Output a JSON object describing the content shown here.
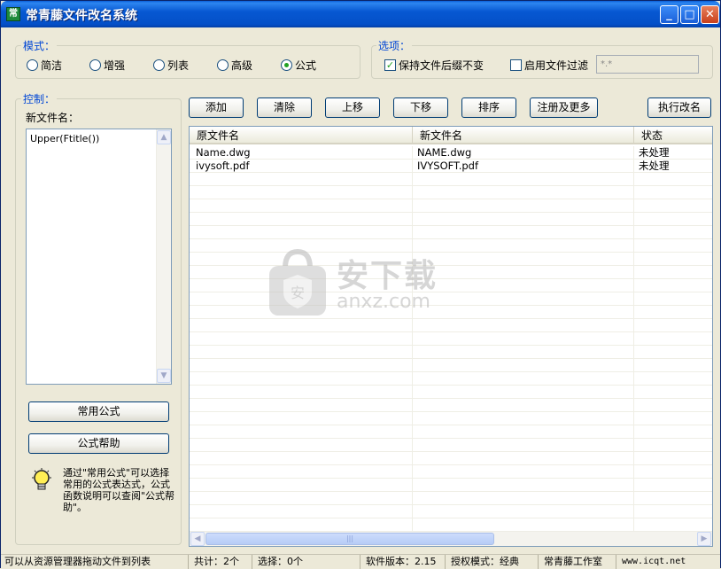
{
  "window": {
    "title": "常青藤文件改名系统",
    "icon_glyph": "常",
    "minimize_glyph": "_",
    "maximize_glyph": "□",
    "close_glyph": "✕"
  },
  "mode": {
    "legend": "模式：",
    "options": [
      {
        "label": "简洁",
        "selected": false
      },
      {
        "label": "增强",
        "selected": false
      },
      {
        "label": "列表",
        "selected": false
      },
      {
        "label": "高级",
        "selected": false
      },
      {
        "label": "公式",
        "selected": true
      }
    ]
  },
  "options": {
    "legend": "选项：",
    "keep_ext_label": "保持文件后缀不变",
    "keep_ext_checked": true,
    "filter_label": "启用文件过滤",
    "filter_checked": false,
    "filter_value": "*.*",
    "check_glyph": "✓"
  },
  "control": {
    "legend": "控制：",
    "new_name_label": "新文件名：",
    "formula": "Upper(Ftitle())",
    "common_formula_button": "常用公式",
    "formula_help_button": "公式帮助",
    "tip": "通过\"常用公式\"可以选择常用的公式表达式，公式函数说明可以查阅\"公式帮助\"。",
    "scroll_up_glyph": "▲",
    "scroll_down_glyph": "▼"
  },
  "toolbar": {
    "add": "添加",
    "clear": "清除",
    "move_up": "上移",
    "move_down": "下移",
    "sort": "排序",
    "register": "注册及更多",
    "execute": "执行改名"
  },
  "file_list": {
    "columns": [
      "原文件名",
      "新文件名",
      "状态"
    ],
    "rows": [
      {
        "original": "Name.dwg",
        "new": "NAME.dwg",
        "status": "未处理"
      },
      {
        "original": "ivysoft.pdf",
        "new": "IVYSOFT.pdf",
        "status": "未处理"
      }
    ],
    "scroll_left_glyph": "◀",
    "scroll_right_glyph": "▶",
    "thumb_grip": "|||"
  },
  "watermark": {
    "text_cn": "安下载",
    "text_en": "anxz.com",
    "shield_glyph": "安"
  },
  "statusbar": {
    "hint": "可以从资源管理器拖动文件到列表",
    "total": "共计：2个",
    "selected": "选择：0个",
    "version": "软件版本：2.15",
    "license": "授权模式：经典",
    "studio": "常青藤工作室",
    "website": "www.icqt.net"
  }
}
